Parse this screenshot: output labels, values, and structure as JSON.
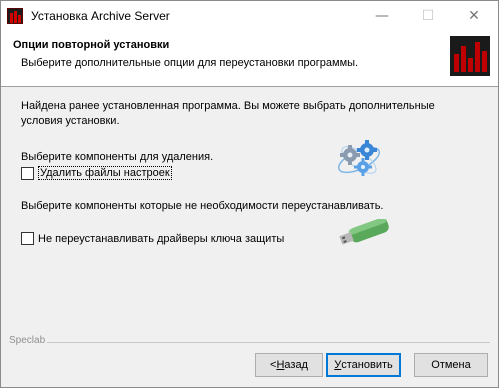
{
  "window": {
    "title": "Установка Archive Server",
    "minimize_glyph": "—",
    "maximize_glyph": "☐",
    "close_glyph": "✕"
  },
  "header": {
    "title": "Опции повторной установки",
    "subtitle": "Выберите дополнительные опции для переустановки программы."
  },
  "body": {
    "intro": "Найдена ранее установленная программа. Вы можете выбрать дополнительные условия установки.",
    "remove_caption": "Выберите компоненты для удаления.",
    "checkbox_remove_settings": {
      "label": "Удалить файлы настроек",
      "checked": false
    },
    "keep_caption": "Выберите компоненты которые не необходимости переустанавливать.",
    "checkbox_skip_drivers": {
      "label": "Не переустанавливать драйверы ключа защиты",
      "checked": false
    }
  },
  "footer": {
    "brand": "Speclab",
    "back": {
      "prefix": "< ",
      "hotkey": "Н",
      "rest": "азад"
    },
    "install": {
      "hotkey": "У",
      "rest": "становить"
    },
    "cancel": "Отмена"
  },
  "colors": {
    "accent": "#0078d7",
    "brand_red": "#d40000",
    "usb_green": "#5aa85a"
  }
}
